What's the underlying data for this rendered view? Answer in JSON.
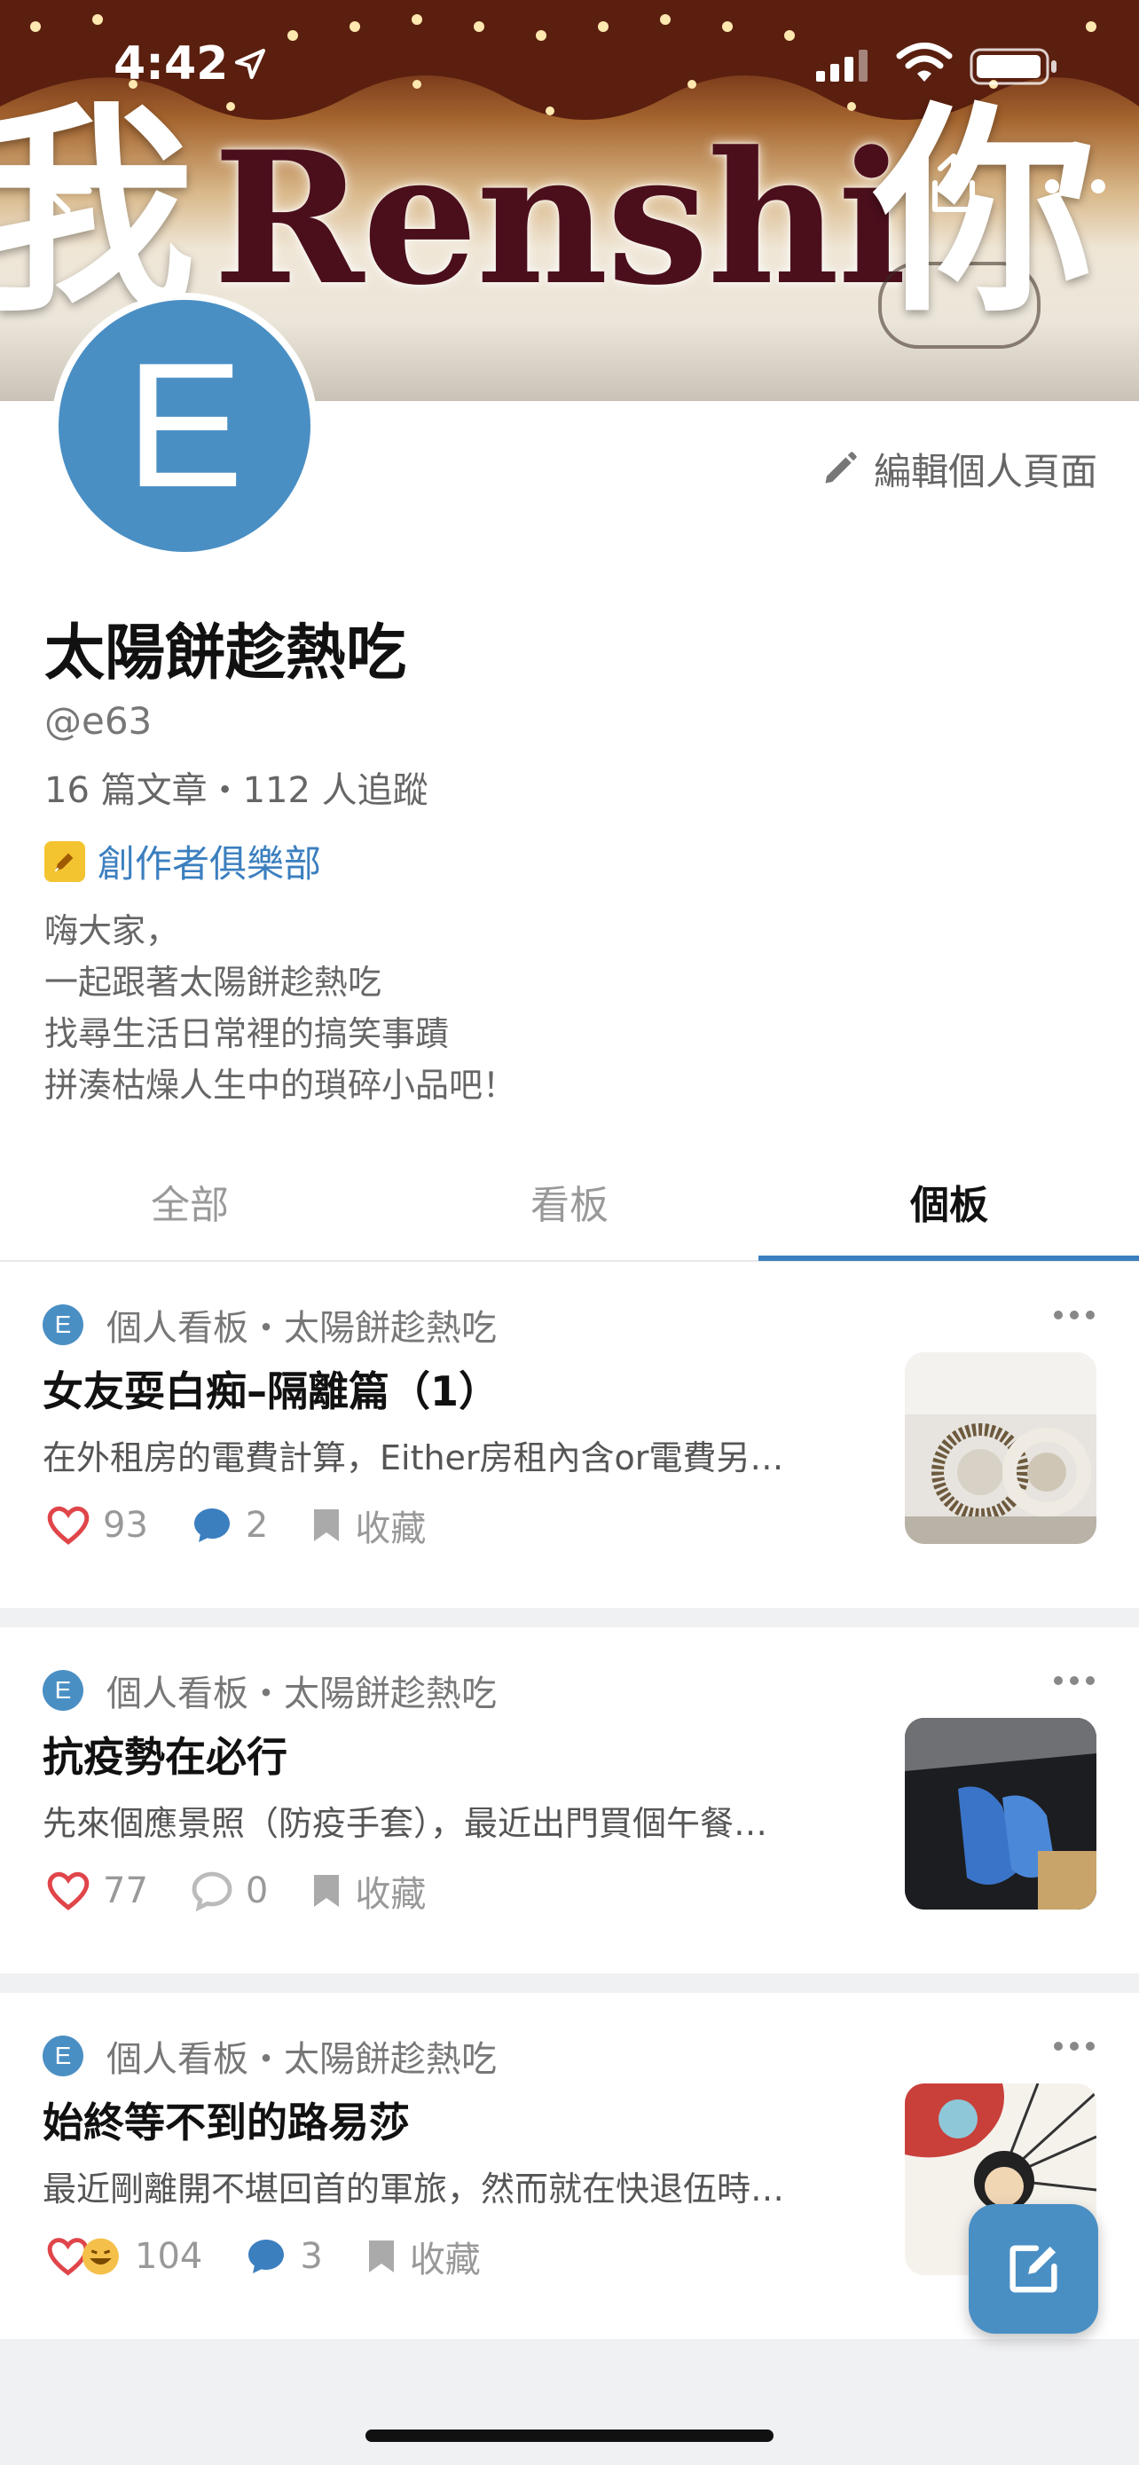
{
  "status_bar": {
    "time": "4:42"
  },
  "cover": {
    "sign_text": "Renshi",
    "left_char": "我",
    "right_char": "你"
  },
  "profile": {
    "avatar_letter": "E",
    "edit_label": "編輯個人頁面",
    "name": "太陽餅趁熱吃",
    "handle": "@e63",
    "stats": "16 篇文章・112 人追蹤",
    "club_label": "創作者俱樂部",
    "bio": [
      "嗨大家，",
      "一起跟著太陽餅趁熱吃",
      "找尋生活日常裡的搞笑事蹟",
      "拼湊枯燥人生中的瑣碎小品吧！"
    ]
  },
  "tabs": [
    {
      "label": "全部",
      "active": false
    },
    {
      "label": "看板",
      "active": false
    },
    {
      "label": "個板",
      "active": true
    }
  ],
  "posts": [
    {
      "avatar_letter": "E",
      "meta": "個人看板・太陽餅趁熱吃",
      "title": "女友耍白痴–隔離篇（1）",
      "excerpt": "在外租房的電費計算，Either房租內含or電費另…",
      "likes": "93",
      "comments": "2",
      "save_label": "收藏"
    },
    {
      "avatar_letter": "E",
      "meta": "個人看板・太陽餅趁熱吃",
      "title": "抗疫勢在必行",
      "excerpt": "先來個應景照（防疫手套），最近出門買個午餐…",
      "likes": "77",
      "comments": "0",
      "save_label": "收藏"
    },
    {
      "avatar_letter": "E",
      "meta": "個人看板・太陽餅趁熱吃",
      "title": "始終等不到的路易莎",
      "excerpt": "最近剛離開不堪回首的軍旅，然而就在快退伍時…",
      "likes": "104",
      "comments": "3",
      "save_label": "收藏"
    }
  ],
  "colors": {
    "accent": "#3b7fbf",
    "avatar": "#4a8fc4",
    "heart": "#e0454a"
  }
}
